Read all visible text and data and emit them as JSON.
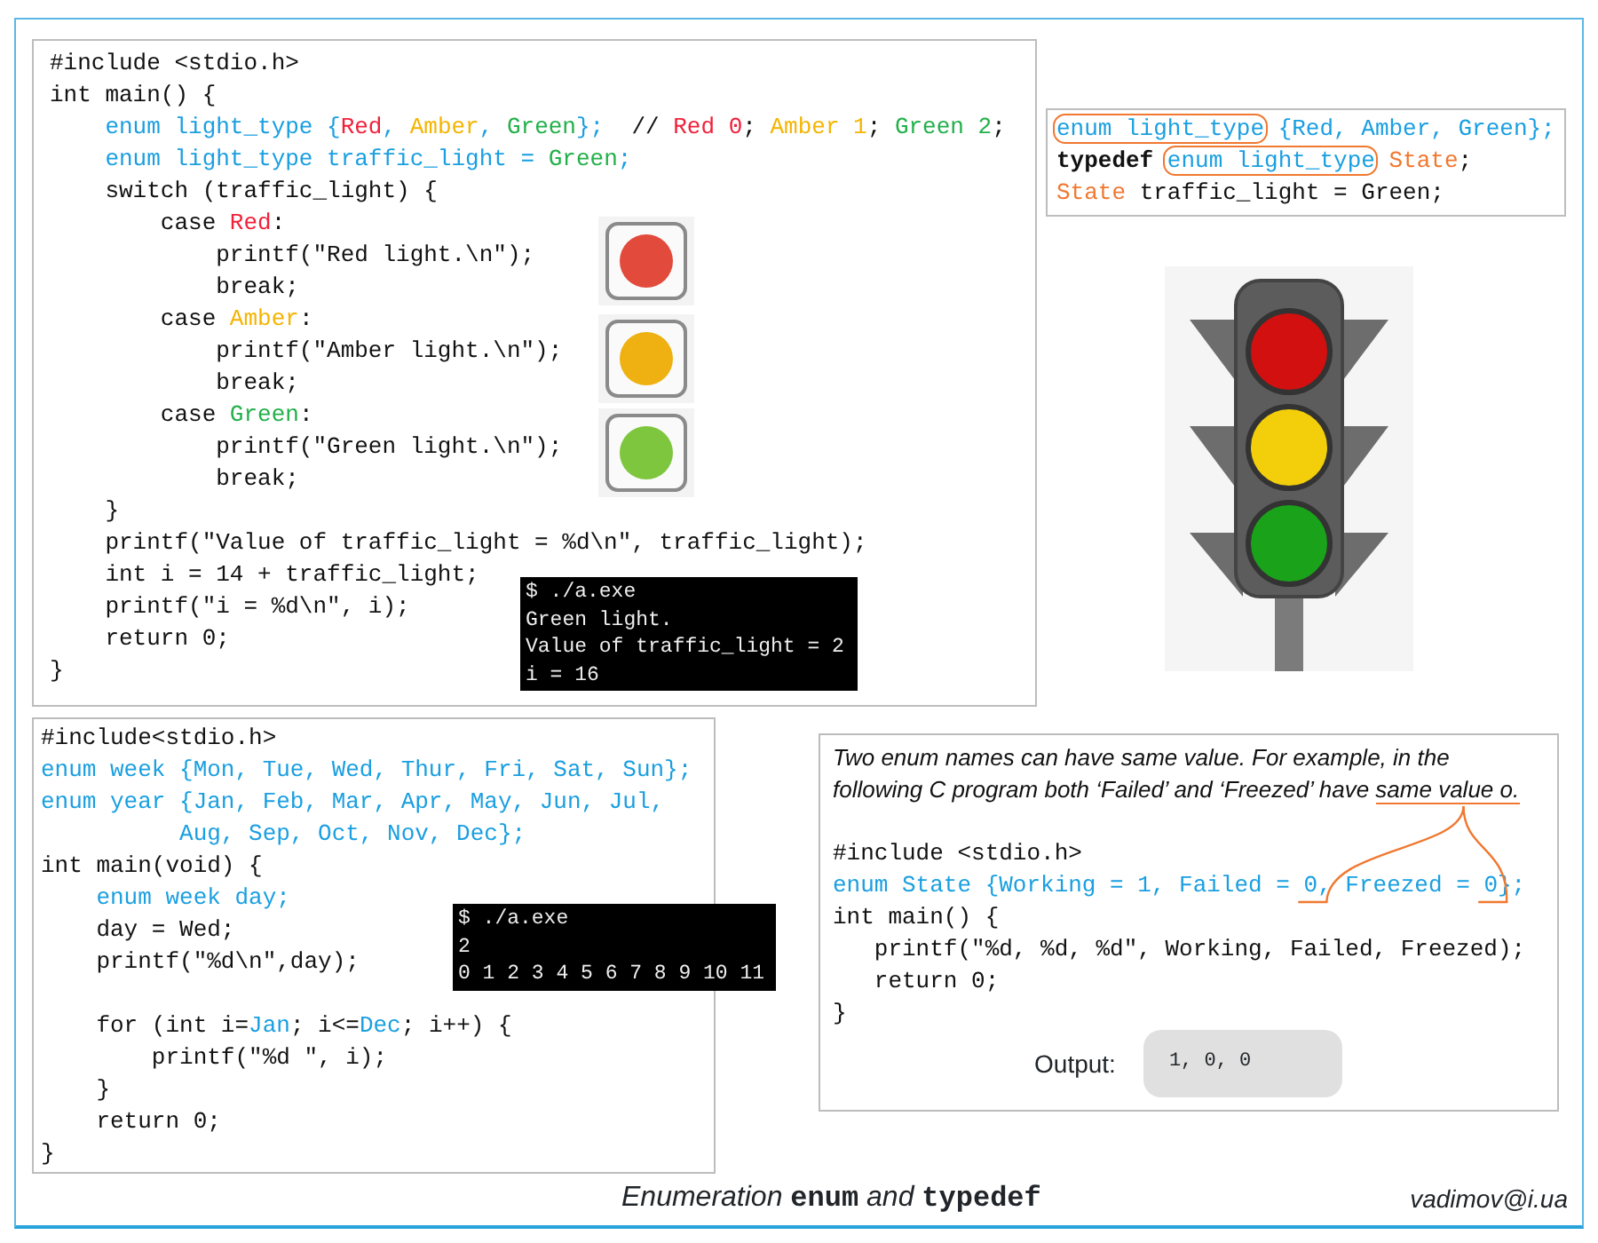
{
  "main_program": {
    "lines": [
      {
        "segments": [
          {
            "text": "#include <stdio.h>"
          }
        ]
      },
      {
        "segments": [
          {
            "text": "int main() {"
          }
        ]
      },
      {
        "segments": [
          {
            "text": "    enum light_type {",
            "color": "#1a9fe0"
          },
          {
            "text": "Red",
            "color": "#f0203a"
          },
          {
            "text": ", ",
            "color": "#1a9fe0"
          },
          {
            "text": "Amber",
            "color": "#f5b400"
          },
          {
            "text": ", ",
            "color": "#1a9fe0"
          },
          {
            "text": "Green",
            "color": "#22b04a"
          },
          {
            "text": "};",
            "color": "#1a9fe0"
          },
          {
            "text": "  // "
          },
          {
            "text": "Red 0",
            "color": "#f0203a"
          },
          {
            "text": "; "
          },
          {
            "text": "Amber 1",
            "color": "#f5b400"
          },
          {
            "text": "; "
          },
          {
            "text": "Green 2",
            "color": "#22b04a"
          },
          {
            "text": ";"
          }
        ]
      },
      {
        "segments": [
          {
            "text": "    enum light_type traffic_light = ",
            "color": "#1a9fe0"
          },
          {
            "text": "Green",
            "color": "#22b04a"
          },
          {
            "text": ";",
            "color": "#1a9fe0"
          }
        ]
      },
      {
        "segments": [
          {
            "text": "    switch (traffic_light) {"
          }
        ]
      },
      {
        "segments": [
          {
            "text": "        case "
          },
          {
            "text": "Red",
            "color": "#f0203a"
          },
          {
            "text": ":"
          }
        ]
      },
      {
        "segments": [
          {
            "text": "            printf(\"Red light.\\n\");"
          }
        ]
      },
      {
        "segments": [
          {
            "text": "            break;"
          }
        ]
      },
      {
        "segments": [
          {
            "text": "        case "
          },
          {
            "text": "Amber",
            "color": "#f5b400"
          },
          {
            "text": ":"
          }
        ]
      },
      {
        "segments": [
          {
            "text": "            printf(\"Amber light.\\n\");"
          }
        ]
      },
      {
        "segments": [
          {
            "text": "            break;"
          }
        ]
      },
      {
        "segments": [
          {
            "text": "        case "
          },
          {
            "text": "Green",
            "color": "#22b04a"
          },
          {
            "text": ":"
          }
        ]
      },
      {
        "segments": [
          {
            "text": "            printf(\"Green light.\\n\");"
          }
        ]
      },
      {
        "segments": [
          {
            "text": "            break;"
          }
        ]
      },
      {
        "segments": [
          {
            "text": "    }"
          }
        ]
      },
      {
        "segments": [
          {
            "text": "    printf(\"Value of traffic_light = %d\\n\", traffic_light);"
          }
        ]
      },
      {
        "segments": [
          {
            "text": "    int i = 14 + traffic_light;"
          }
        ]
      },
      {
        "segments": [
          {
            "text": "    printf(\"i = %d\\n\", i);"
          }
        ]
      },
      {
        "segments": [
          {
            "text": "    return 0;"
          }
        ]
      },
      {
        "segments": [
          {
            "text": "}"
          }
        ]
      }
    ],
    "light_icons": [
      {
        "color": "#e24a3b"
      },
      {
        "color": "#eeb111"
      },
      {
        "color": "#7dc63e"
      }
    ],
    "terminal": {
      "lines": [
        "$ ./a.exe",
        "Green light.",
        "Value of traffic_light = 2",
        "i = 16"
      ]
    }
  },
  "typedef_box": {
    "lines": [
      {
        "segments": [
          {
            "text": "enum light_type",
            "color": "#1a9fe0",
            "circled": true
          },
          {
            "text": " {Red, Amber, Green};",
            "color": "#1a9fe0"
          }
        ]
      },
      {
        "segments": [
          {
            "text": "typedef ",
            "bold": true
          },
          {
            "text": "enum light_type",
            "color": "#1a9fe0",
            "circled": true
          },
          {
            "text": " State",
            "color": "#f07830"
          },
          {
            "text": ";"
          }
        ]
      },
      {
        "segments": [
          {
            "text": "State",
            "color": "#f07830"
          },
          {
            "text": " traffic_light = Green;"
          }
        ]
      }
    ]
  },
  "week_program": {
    "lines": [
      {
        "segments": [
          {
            "text": "#include<stdio.h>"
          }
        ]
      },
      {
        "segments": [
          {
            "text": "enum week {Mon, Tue, Wed, Thur, Fri, Sat, Sun};",
            "color": "#1a9fe0"
          }
        ]
      },
      {
        "segments": [
          {
            "text": "enum year {Jan, Feb, Mar, Apr, May, Jun, Jul,",
            "color": "#1a9fe0"
          }
        ]
      },
      {
        "segments": [
          {
            "text": "          Aug, Sep, Oct, Nov, Dec};",
            "color": "#1a9fe0"
          }
        ]
      },
      {
        "segments": [
          {
            "text": "int main(void) {"
          }
        ]
      },
      {
        "segments": [
          {
            "text": "    enum week day;",
            "color": "#1a9fe0"
          }
        ]
      },
      {
        "segments": [
          {
            "text": "    day = Wed;"
          }
        ]
      },
      {
        "segments": [
          {
            "text": "    printf(\"%d\\n\",day);"
          }
        ]
      },
      {
        "gap_before": true,
        "segments": [
          {
            "text": "    for (int i="
          },
          {
            "text": "Jan",
            "color": "#1a9fe0"
          },
          {
            "text": "; i<="
          },
          {
            "text": "Dec",
            "color": "#1a9fe0"
          },
          {
            "text": "; i++) {"
          }
        ]
      },
      {
        "segments": [
          {
            "text": "        printf(\"%d \", i);"
          }
        ]
      },
      {
        "segments": [
          {
            "text": "    }"
          }
        ]
      },
      {
        "segments": [
          {
            "text": "    return 0;"
          }
        ]
      },
      {
        "segments": [
          {
            "text": "}"
          }
        ]
      }
    ],
    "terminal": {
      "lines": [
        "$ ./a.exe",
        "2",
        "0 1 2 3 4 5 6 7 8 9 10 11"
      ]
    }
  },
  "same_value_note": {
    "intro": [
      {
        "text": "Two enum names can have same value. For example, in the following C program both ‘Failed’ and ‘Freezed’ have "
      },
      {
        "text": "same value o.",
        "underlined": true
      }
    ],
    "lines": [
      {
        "segments": [
          {
            "text": "#include <stdio.h>"
          }
        ]
      },
      {
        "segments": [
          {
            "text": "enum State {Working = 1, Failed = ",
            "color": "#1a9fe0"
          },
          {
            "text": "0",
            "color": "#1a9fe0",
            "pointed": true
          },
          {
            "text": ", Freezed = ",
            "color": "#1a9fe0"
          },
          {
            "text": "0",
            "color": "#1a9fe0",
            "pointed": true
          },
          {
            "text": "};",
            "color": "#1a9fe0"
          }
        ]
      },
      {
        "segments": [
          {
            "text": "int main() {"
          }
        ]
      },
      {
        "segments": [
          {
            "text": "   printf(\"%d, %d, %d\", Working, Failed, Freezed);"
          }
        ]
      },
      {
        "segments": [
          {
            "text": "   return 0;"
          }
        ]
      },
      {
        "segments": [
          {
            "text": "}"
          }
        ]
      }
    ],
    "output": {
      "label": "Output:",
      "value": "1, 0, 0"
    }
  },
  "footer": {
    "title": "Enumeration **enum** and **typedef**",
    "author": "vadimov@i.ua"
  }
}
